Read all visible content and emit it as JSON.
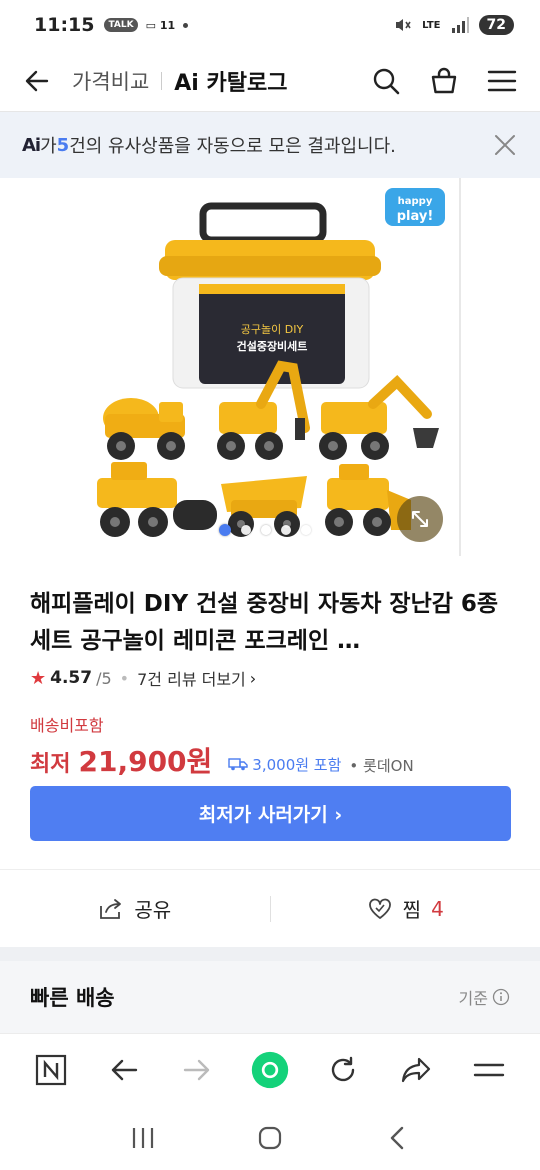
{
  "status_bar": {
    "time": "11:15",
    "talk_badge": "TALK",
    "network_label": "11",
    "signal_label": "LTE",
    "battery": "72"
  },
  "header": {
    "breadcrumb": "가격비교",
    "title": "Ai 카탈로그"
  },
  "banner": {
    "ai_logo": "Ai",
    "prefix": "가 ",
    "count": "5",
    "suffix": "건의 유사상품을 자동으로 모은 결과입니다."
  },
  "gallery": {
    "brand_logo": "happy play!",
    "box_label_line1": "공구놀이 DIY",
    "box_label_line2": "건설중장비세트",
    "current_image": 1,
    "image_count": 5
  },
  "product": {
    "title": "해피플레이 DIY 건설 중장비 자동차 장난감 6종 세트 공구놀이 레미콘 포크레인 …",
    "rating": "4.57",
    "rating_max": "/5",
    "reviews": "7건 리뷰 더보기",
    "shipping_included": "배송비포함",
    "lowest_label": "최저",
    "price": "21,900원",
    "shipping_fee": "3,000원 포함",
    "shop": "롯데ON"
  },
  "cta": {
    "label": "최저가 사러가기 ›"
  },
  "actions": {
    "share_label": "공유",
    "zzim_label": "찜",
    "zzim_count": "4"
  },
  "section": {
    "title": "빠른 배송",
    "basis": "기준"
  },
  "colors": {
    "accent": "#4f7ef2",
    "price_red": "#d13a3f",
    "banner_bg": "#eef2f8",
    "toy_yellow": "#f5b81c"
  }
}
